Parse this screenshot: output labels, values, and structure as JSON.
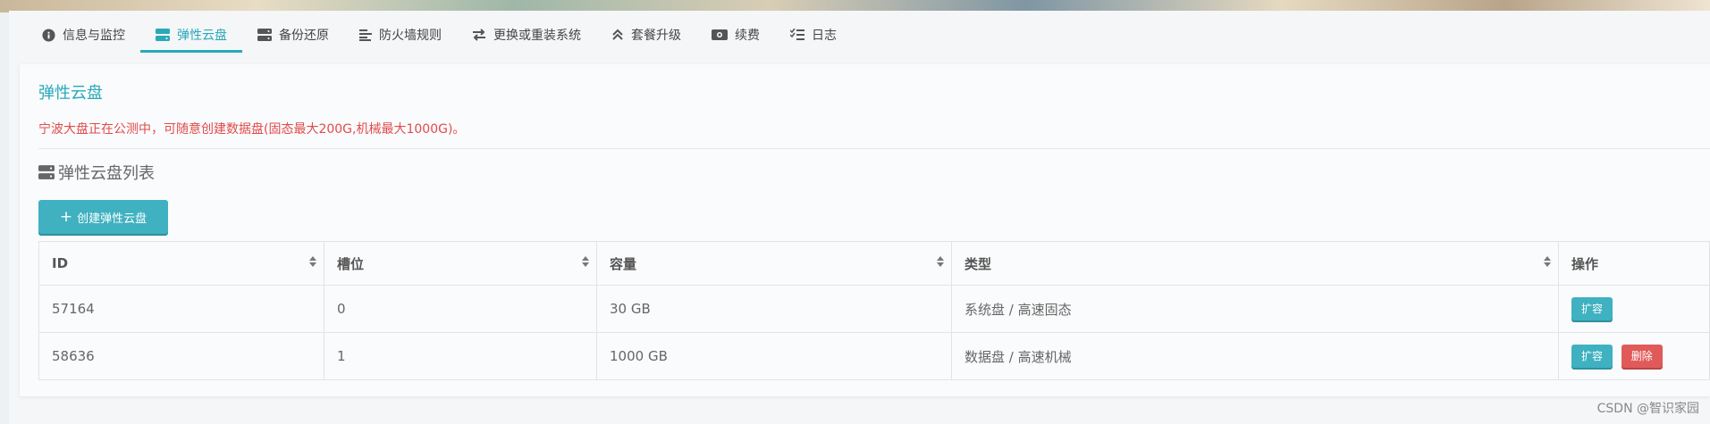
{
  "tabs": [
    {
      "label": "信息与监控",
      "icon": "info-icon"
    },
    {
      "label": "弹性云盘",
      "icon": "disk-icon",
      "active": true
    },
    {
      "label": "备份还原",
      "icon": "server-icon"
    },
    {
      "label": "防火墙规则",
      "icon": "align-left-icon"
    },
    {
      "label": "更换或重装系统",
      "icon": "exchange-icon"
    },
    {
      "label": "套餐升级",
      "icon": "chevrons-up-icon"
    },
    {
      "label": "续费",
      "icon": "money-icon"
    },
    {
      "label": "日志",
      "icon": "list-check-icon"
    }
  ],
  "panel": {
    "title": "弹性云盘",
    "notice": "宁波大盘正在公测中，可随意创建数据盘(固态最大200G,机械最大1000G)。",
    "list_title": "弹性云盘列表",
    "create_button": "创建弹性云盘"
  },
  "table": {
    "headers": [
      "ID",
      "槽位",
      "容量",
      "类型",
      "操作"
    ],
    "rows": [
      {
        "id": "57164",
        "slot": "0",
        "capacity": "30 GB",
        "type": "系统盘 / 高速固态",
        "actions": [
          "扩容"
        ]
      },
      {
        "id": "58636",
        "slot": "1",
        "capacity": "1000 GB",
        "type": "数据盘 / 高速机械",
        "actions": [
          "扩容",
          "删除"
        ]
      }
    ]
  },
  "watermark": "CSDN @智识家园",
  "colors": {
    "accent": "#29a9b9",
    "danger": "#e05a5a",
    "notice": "#e24b4b"
  }
}
